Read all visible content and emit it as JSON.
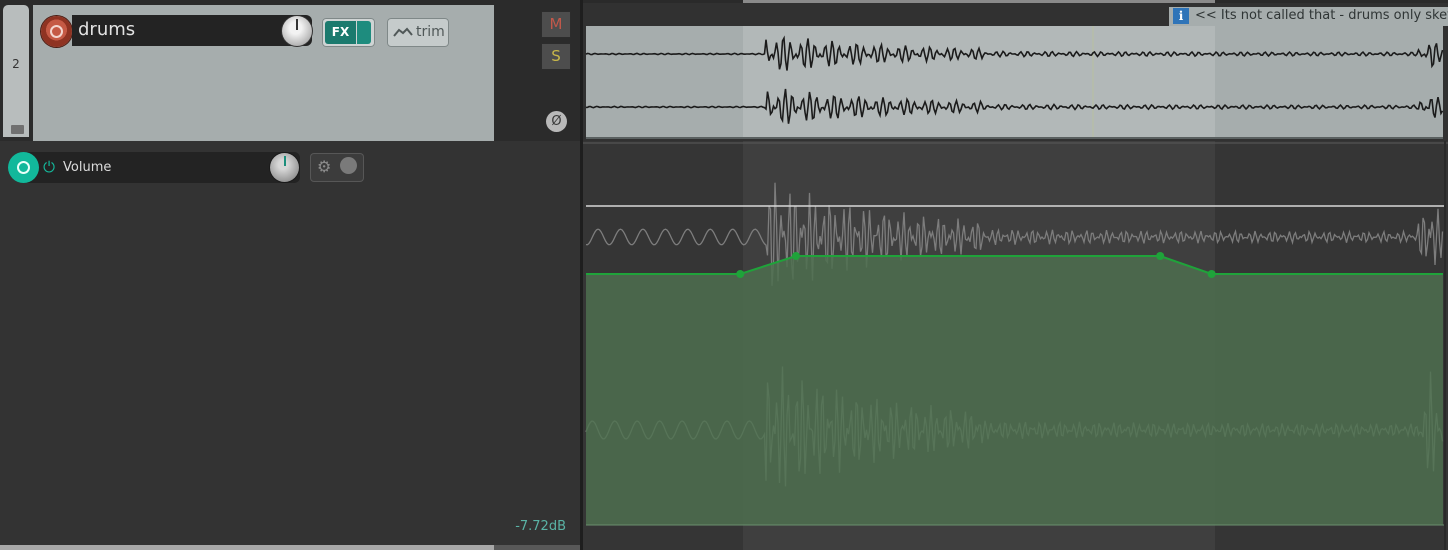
{
  "track": {
    "number": "2",
    "name": "drums",
    "fx_label": "FX",
    "trim_label": "trim",
    "mute_label": "M",
    "solo_label": "S",
    "phase_symbol": "Ø"
  },
  "envelope": {
    "name": "Volume",
    "value": "-7.72dB",
    "power_symbol": "⏻",
    "gear_symbol": "⚙"
  },
  "item": {
    "info_symbol": "i",
    "take_name": "<< Its not called that - drums only sketch-glued.wav"
  },
  "colors": {
    "envelope": "#1fa33a",
    "envelope_fill": "#4d6e4f",
    "record_arm": "#c55a45",
    "envelope_arm": "#12b89b",
    "item_bg": "#a6adad",
    "info": "#2f74b8"
  },
  "envelope_points": [
    {
      "time": 0.18,
      "value": 0.5
    },
    {
      "time": 0.245,
      "value": 0.55
    },
    {
      "time": 0.67,
      "value": 0.55
    },
    {
      "time": 0.73,
      "value": 0.5
    }
  ]
}
